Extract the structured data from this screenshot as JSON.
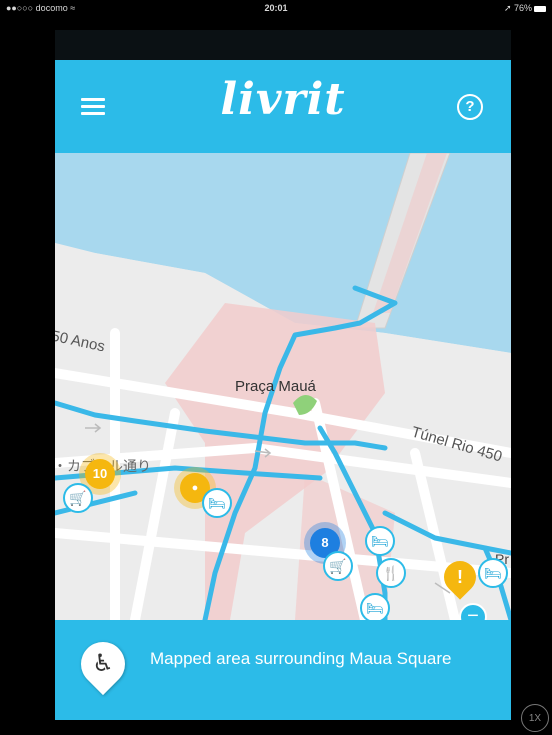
{
  "status_bar": {
    "carrier": "●●○○○ docomo ≈",
    "time": "20:01",
    "battery": "➚ 76%"
  },
  "header": {
    "logo": "livrit",
    "menu_icon": "hamburger-icon",
    "help_label": "?"
  },
  "map": {
    "labels": {
      "anos": "50 Anos",
      "praca": "Praça Mauá",
      "tunel": "Túnel Rio 450",
      "kabural": "・カブラル通り",
      "pr": "Pr"
    },
    "clusters": [
      {
        "count": "10",
        "color": "#f5b70f"
      },
      {
        "count": "8",
        "color": "#1e7fe0"
      }
    ],
    "poi_icons": [
      "cart-icon",
      "bed-icon",
      "restaurant-icon",
      "warning-icon"
    ],
    "zoom_out_label": "−"
  },
  "footer": {
    "text": "Mapped area surrounding Maua Square",
    "icon": "wheelchair-icon"
  },
  "zoom_badge": "1X",
  "colors": {
    "brand": "#2cbbe8",
    "route": "#3ab8e8",
    "water": "#a8d8ee",
    "warning": "#f5b70f",
    "cluster_blue": "#1e7fe0"
  }
}
